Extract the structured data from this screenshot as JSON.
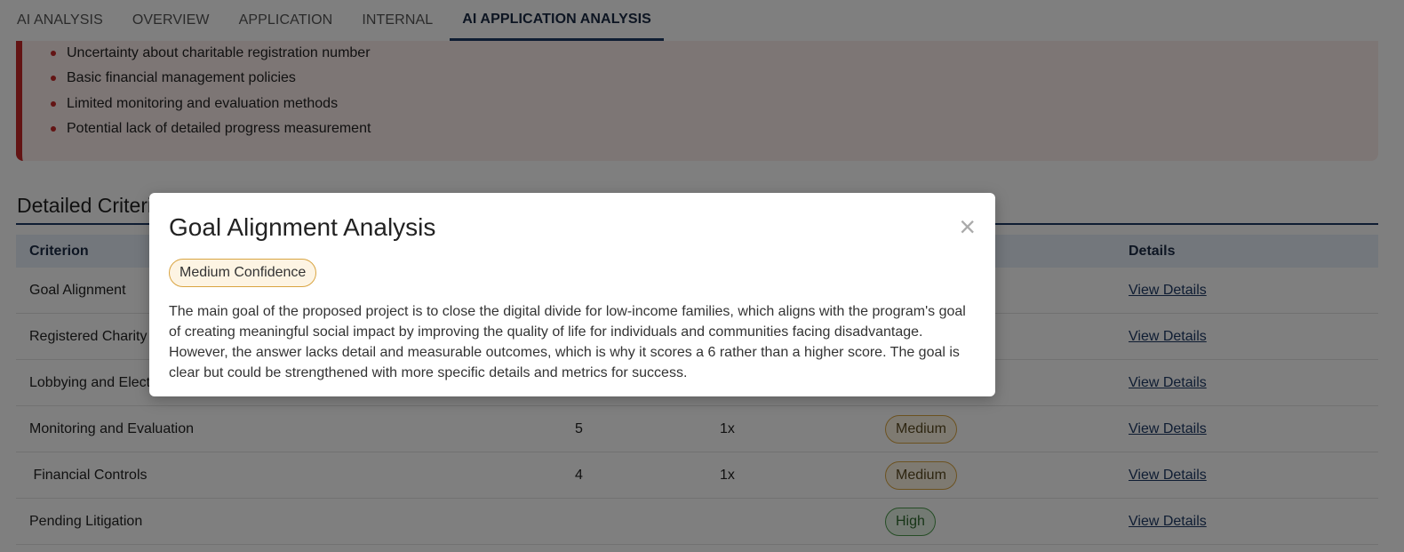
{
  "tabs": [
    {
      "label": "AI ANALYSIS",
      "active": false
    },
    {
      "label": "OVERVIEW",
      "active": false
    },
    {
      "label": "APPLICATION",
      "active": false
    },
    {
      "label": "INTERNAL",
      "active": false
    },
    {
      "label": "AI APPLICATION ANALYSIS",
      "active": true
    }
  ],
  "weaknesses": [
    "Uncertainty about charitable registration number",
    "Basic financial management policies",
    "Limited monitoring and evaluation methods",
    "Potential lack of detailed progress measurement"
  ],
  "section": {
    "title": "Detailed Criteria"
  },
  "table": {
    "headers": {
      "criterion": "Criterion",
      "details": "Details"
    },
    "rows": [
      {
        "criterion": "Goal Alignment",
        "score": "",
        "weight": "",
        "confidence": "",
        "details": "View Details"
      },
      {
        "criterion": "Registered Charity",
        "score": "",
        "weight": "",
        "confidence": "",
        "details": "View Details"
      },
      {
        "criterion": "Lobbying and Elections",
        "score": "",
        "weight": "",
        "confidence": "",
        "details": "View Details"
      },
      {
        "criterion": "Monitoring and Evaluation",
        "score": "5",
        "weight": "1x",
        "confidence": "Medium",
        "details": "View Details"
      },
      {
        "criterion": " Financial Controls",
        "score": "4",
        "weight": "1x",
        "confidence": "Medium",
        "details": "View Details"
      },
      {
        "criterion": "Pending Litigation",
        "score": "",
        "weight": "",
        "confidence": "High",
        "details": "View Details"
      }
    ]
  },
  "modal": {
    "title": "Goal Alignment Analysis",
    "close_icon": "×",
    "confidence": "Medium Confidence",
    "text": "The main goal of the proposed project is to close the digital divide for low-income families, which aligns with the program's goal of creating meaningful social impact by improving the quality of life for individuals and communities facing disadvantage. However, the answer lacks detail and measurable outcomes, which is why it scores a 6 rather than a higher score. The goal is clear but could be strengthened with more specific details and metrics for success."
  },
  "colors": {
    "accent": "#1e3a66",
    "warning": "#c62828",
    "medium": "#d9a441",
    "high": "#4c9a4c"
  }
}
